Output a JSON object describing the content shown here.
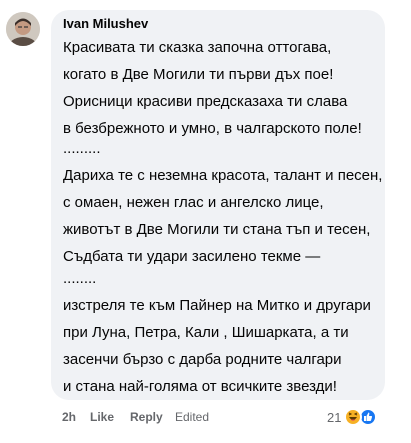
{
  "comment": {
    "author": "Ivan Milushev",
    "lines": [
      "Красивата ти сказка започна оттогава,",
      "когато в Две Могили ти първи дъх пое!",
      "Орисници красиви предсказаха ти слава",
      "в безбрежното и умно, в чалгарското поле!",
      ".........",
      "Дариха те с неземна красота, талант и песен,",
      "с омаен, нежен глас и ангелско лице,",
      "животът в Две Могили ти стана тъп и тесен,",
      "Съдбата ти удари засилено текме —",
      "........",
      "изстреля те към Пайнер на Митко и другари",
      "при Луна, Петра, Кали , Шишарката, а ти",
      "засенчи бързо с дарба родните чалгари",
      "и стана най-голяма от всичките звезди!"
    ]
  },
  "actions": {
    "time": "2h",
    "like_label": "Like",
    "reply_label": "Reply",
    "edited_label": "Edited",
    "reaction_count": "21"
  },
  "reactions": [
    {
      "icon": "haha-emoji-icon",
      "color": "#f7b125"
    },
    {
      "icon": "like-reaction-icon",
      "color": "#1877f2"
    }
  ]
}
